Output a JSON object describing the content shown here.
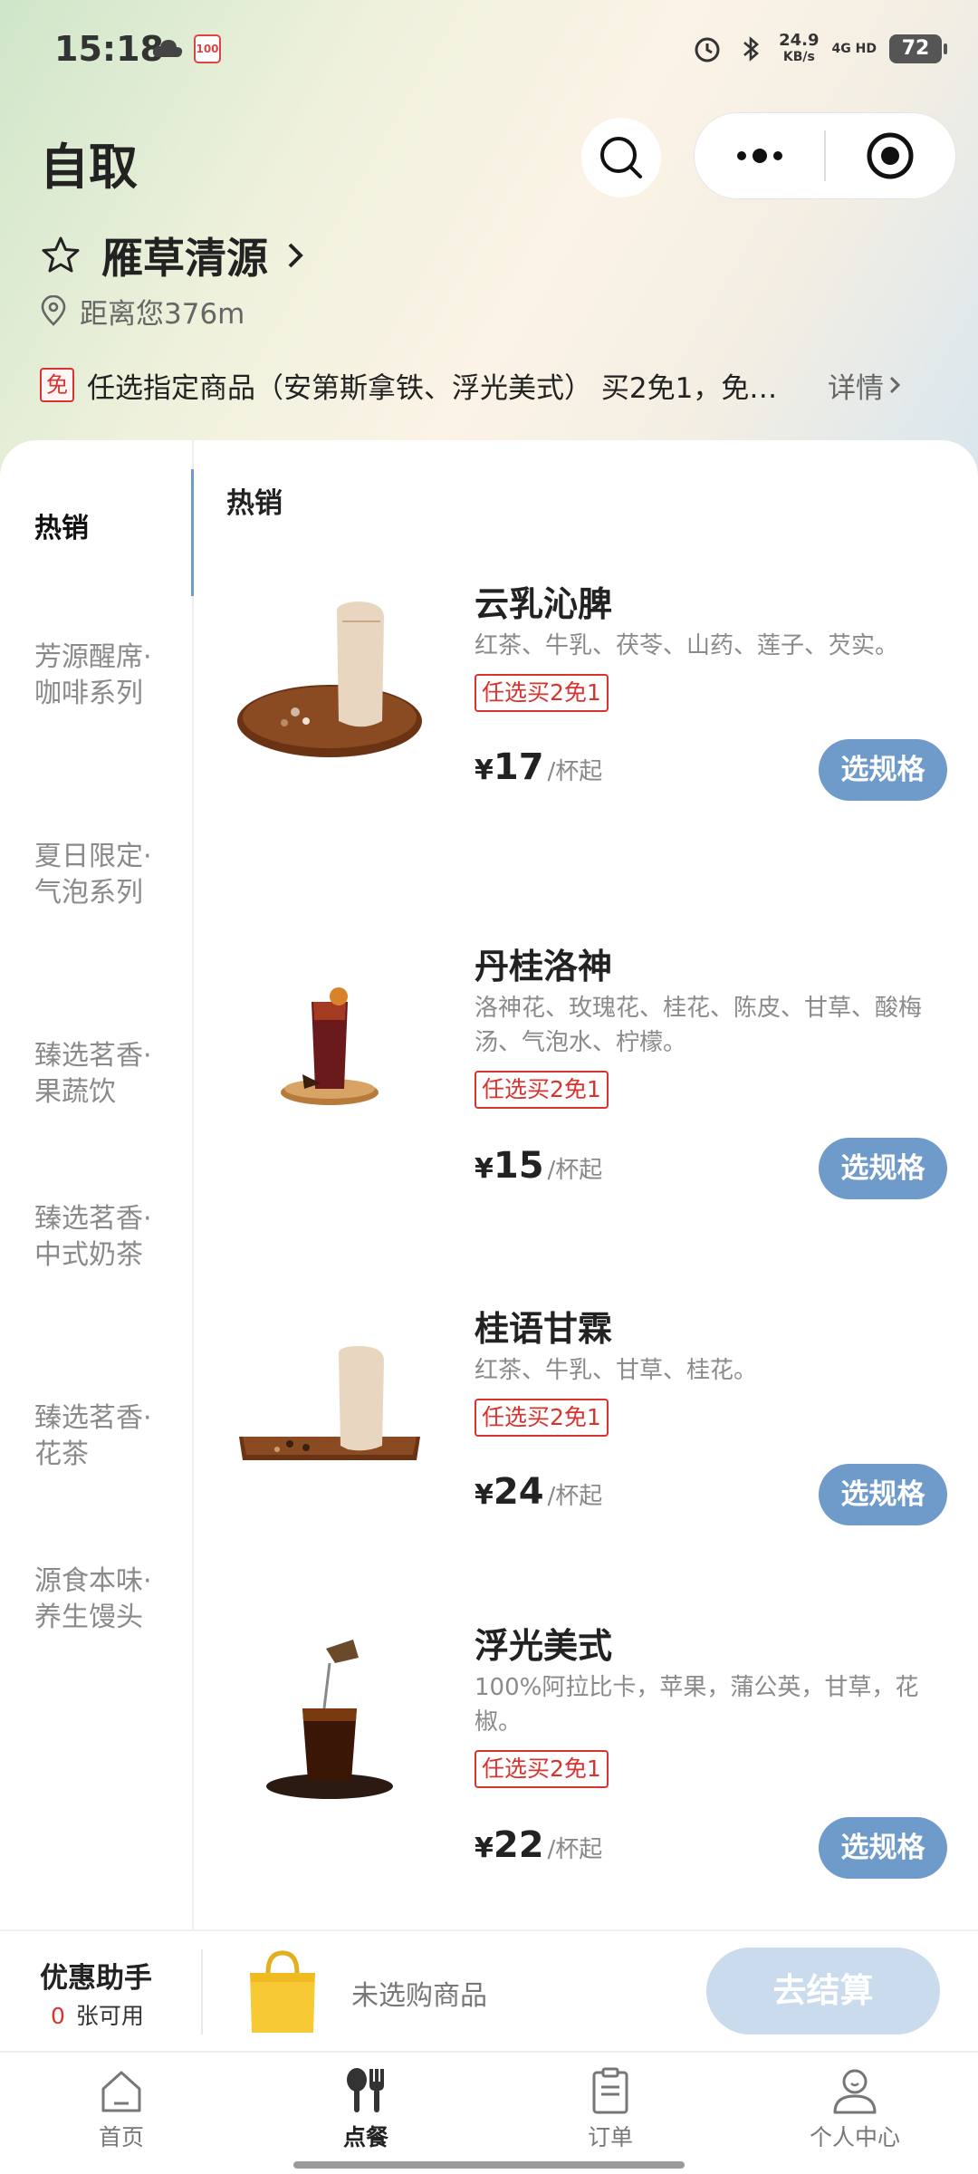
{
  "status_bar": {
    "time": "15:18",
    "speed_value": "24.9",
    "speed_unit": "KB/s",
    "network": "4G HD",
    "battery": "72",
    "calendar_label": "100"
  },
  "header": {
    "title": "自取",
    "store_name": "雁草清源",
    "distance": "距离您376m"
  },
  "promo": {
    "badge": "免",
    "text": "任选指定商品（安第斯拿铁、浮光美式） 买2免1，免…",
    "detail": "详情"
  },
  "sidebar": {
    "items": [
      {
        "label": "热销"
      },
      {
        "label": "芳源醒席·咖啡系列"
      },
      {
        "label": "夏日限定·气泡系列"
      },
      {
        "label": "臻选茗香·果蔬饮"
      },
      {
        "label": "臻选茗香·中式奶茶"
      },
      {
        "label": "臻选茗香·花茶"
      },
      {
        "label": "源食本味·养生馒头"
      }
    ]
  },
  "section_title": "热销",
  "products": [
    {
      "name": "云乳沁脾",
      "desc": "红茶、牛乳、茯苓、山药、莲子、芡实。",
      "tag": "任选买2免1",
      "yen": "¥",
      "price": "17",
      "unit": "/杯起",
      "button": "选规格"
    },
    {
      "name": "丹桂洛神",
      "desc": "洛神花、玫瑰花、桂花、陈皮、甘草、酸梅汤、气泡水、柠檬。",
      "tag": "任选买2免1",
      "yen": "¥",
      "price": "15",
      "unit": "/杯起",
      "button": "选规格"
    },
    {
      "name": "桂语甘霖",
      "desc": "红茶、牛乳、甘草、桂花。",
      "tag": "任选买2免1",
      "yen": "¥",
      "price": "24",
      "unit": "/杯起",
      "button": "选规格"
    },
    {
      "name": "浮光美式",
      "desc": "100%阿拉比卡，苹果，蒲公英，甘草，花椒。",
      "tag": "任选买2免1",
      "yen": "¥",
      "price": "22",
      "unit": "/杯起",
      "button": "选规格"
    }
  ],
  "checkout": {
    "coupon_title": "优惠助手",
    "coupon_num": "0",
    "coupon_suffix": "张可用",
    "empty_text": "未选购商品",
    "pay_button": "去结算"
  },
  "tabbar": {
    "items": [
      {
        "label": "首页"
      },
      {
        "label": "点餐"
      },
      {
        "label": "订单"
      },
      {
        "label": "个人中心"
      }
    ]
  },
  "colors": {
    "accent": "#6e9bc9",
    "promo_red": "#d9332f",
    "pay_disabled": "#c9dbec"
  }
}
